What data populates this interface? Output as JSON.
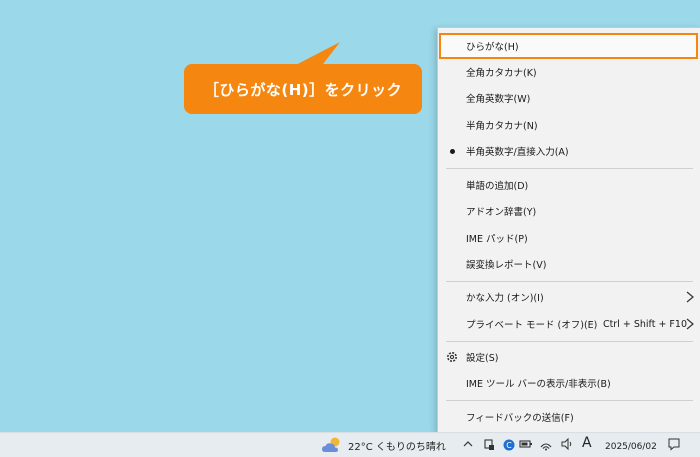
{
  "callout": {
    "text": "［ひらがな(H)］をクリック"
  },
  "menu": {
    "items": [
      {
        "label": "ひらがな(H)"
      },
      {
        "label": "全角カタカナ(K)"
      },
      {
        "label": "全角英数字(W)"
      },
      {
        "label": "半角カタカナ(N)"
      },
      {
        "label": "半角英数字/直接入力(A)"
      },
      {
        "label": "単語の追加(D)"
      },
      {
        "label": "アドオン辞書(Y)"
      },
      {
        "label": "IME パッド(P)"
      },
      {
        "label": "誤変換レポート(V)"
      },
      {
        "label": "かな入力 (オン)(I)"
      },
      {
        "label": "プライベート モード (オフ)(E)",
        "shortcut": "Ctrl + Shift + F10"
      },
      {
        "label": "設定(S)"
      },
      {
        "label": "IME ツール バーの表示/非表示(B)"
      },
      {
        "label": "フィードバックの送信(F)"
      }
    ]
  },
  "taskbar": {
    "weather": "22°C くもりのち晴れ",
    "ime_indicator": "A",
    "date": "2025/06/02"
  },
  "colors": {
    "accent": "#f5860f",
    "desktop": "#9bd8e9"
  }
}
